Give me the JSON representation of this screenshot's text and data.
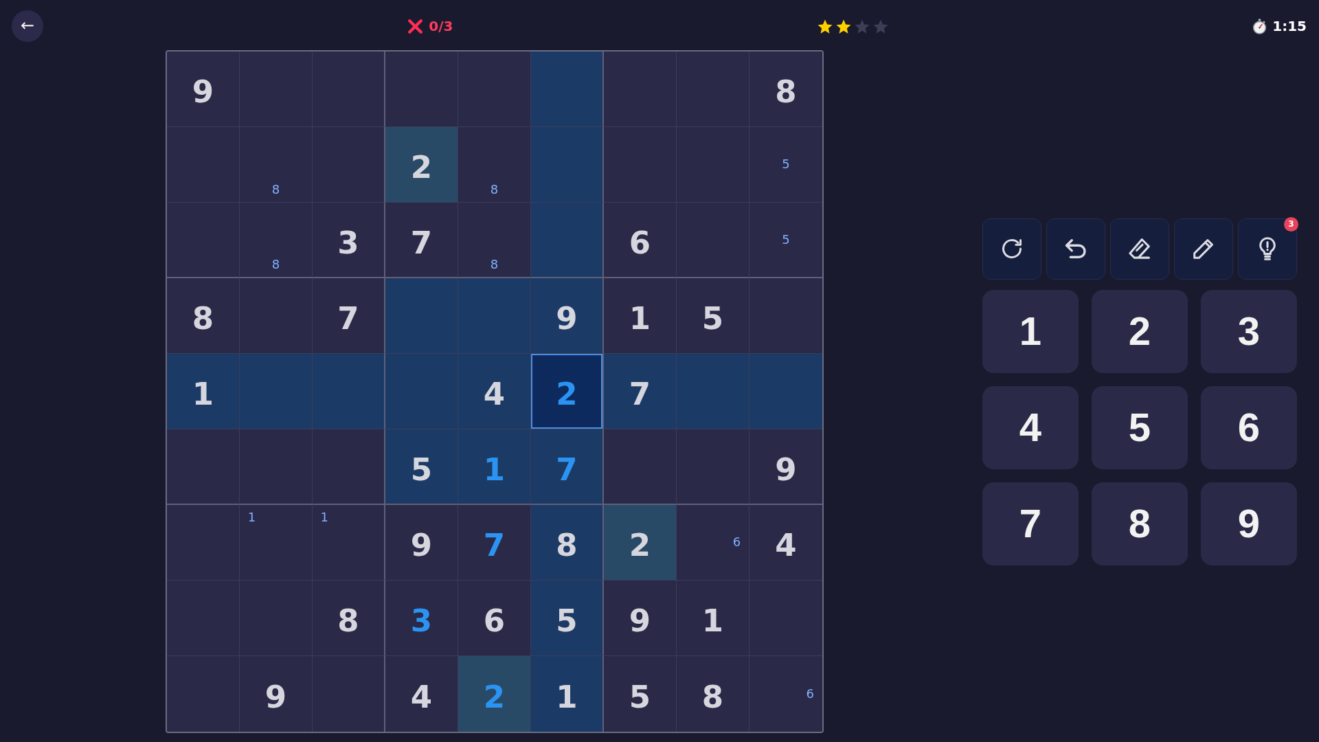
{
  "header": {
    "back_button": {
      "label": "←"
    },
    "mistakes": {
      "text": "0/3"
    },
    "rating": {
      "stars": 2
    },
    "timer": {
      "text": "1:15"
    }
  },
  "board": {
    "rows": [
      {
        "cells": [
          {
            "kind": "given",
            "value": "9",
            "selected": false,
            "related": false,
            "matching": false
          },
          {
            "kind": "empty",
            "selected": false,
            "related": false,
            "matching": false
          },
          {
            "kind": "empty",
            "selected": false,
            "related": false,
            "matching": false
          },
          {
            "kind": "empty",
            "selected": false,
            "related": false,
            "matching": false
          },
          {
            "kind": "empty",
            "selected": false,
            "related": false,
            "matching": false
          },
          {
            "kind": "empty",
            "selected": false,
            "related": true,
            "matching": false
          },
          {
            "kind": "empty",
            "selected": false,
            "related": false,
            "matching": false
          },
          {
            "kind": "empty",
            "selected": false,
            "related": false,
            "matching": false
          },
          {
            "kind": "given",
            "value": "8",
            "selected": false,
            "related": false,
            "matching": false
          }
        ]
      },
      {
        "cells": [
          {
            "kind": "empty",
            "selected": false,
            "related": false,
            "matching": false
          },
          {
            "kind": "notes",
            "notes": [
              {
                "text": "8",
                "kind": "bottomcenter"
              }
            ],
            "selected": false,
            "related": false,
            "matching": false
          },
          {
            "kind": "empty",
            "selected": false,
            "related": false,
            "matching": false
          },
          {
            "kind": "given",
            "value": "2",
            "selected": false,
            "related": false,
            "matching": true
          },
          {
            "kind": "notes",
            "notes": [
              {
                "text": "8",
                "kind": "bottomcenter"
              }
            ],
            "selected": false,
            "related": false,
            "matching": false
          },
          {
            "kind": "empty",
            "selected": false,
            "related": true,
            "matching": false
          },
          {
            "kind": "empty",
            "selected": false,
            "related": false,
            "matching": false
          },
          {
            "kind": "empty",
            "selected": false,
            "related": false,
            "matching": false
          },
          {
            "kind": "notes",
            "notes": [
              {
                "text": "5",
                "kind": "center"
              }
            ],
            "selected": false,
            "related": false,
            "matching": false
          }
        ]
      },
      {
        "cells": [
          {
            "kind": "empty",
            "selected": false,
            "related": false,
            "matching": false
          },
          {
            "kind": "notes",
            "notes": [
              {
                "text": "8",
                "kind": "bottomcenter"
              }
            ],
            "selected": false,
            "related": false,
            "matching": false
          },
          {
            "kind": "given",
            "value": "3",
            "selected": false,
            "related": false,
            "matching": false
          },
          {
            "kind": "given",
            "value": "7",
            "selected": false,
            "related": false,
            "matching": false
          },
          {
            "kind": "notes",
            "notes": [
              {
                "text": "8",
                "kind": "bottomcenter"
              }
            ],
            "selected": false,
            "related": false,
            "matching": false
          },
          {
            "kind": "empty",
            "selected": false,
            "related": true,
            "matching": false
          },
          {
            "kind": "given",
            "value": "6",
            "selected": false,
            "related": false,
            "matching": false
          },
          {
            "kind": "empty",
            "selected": false,
            "related": false,
            "matching": false
          },
          {
            "kind": "notes",
            "notes": [
              {
                "text": "5",
                "kind": "center"
              }
            ],
            "selected": false,
            "related": false,
            "matching": false
          }
        ]
      },
      {
        "cells": [
          {
            "kind": "given",
            "value": "8",
            "selected": false,
            "related": false,
            "matching": false
          },
          {
            "kind": "empty",
            "selected": false,
            "related": false,
            "matching": false
          },
          {
            "kind": "given",
            "value": "7",
            "selected": false,
            "related": false,
            "matching": false
          },
          {
            "kind": "empty",
            "selected": false,
            "related": true,
            "matching": false
          },
          {
            "kind": "empty",
            "selected": false,
            "related": true,
            "matching": false
          },
          {
            "kind": "given",
            "value": "9",
            "selected": false,
            "related": true,
            "matching": false
          },
          {
            "kind": "given",
            "value": "1",
            "selected": false,
            "related": false,
            "matching": false
          },
          {
            "kind": "given",
            "value": "5",
            "selected": false,
            "related": false,
            "matching": false
          },
          {
            "kind": "empty",
            "selected": false,
            "related": false,
            "matching": false
          }
        ]
      },
      {
        "cells": [
          {
            "kind": "given",
            "value": "1",
            "selected": false,
            "related": true,
            "matching": false
          },
          {
            "kind": "empty",
            "selected": false,
            "related": true,
            "matching": false
          },
          {
            "kind": "empty",
            "selected": false,
            "related": true,
            "matching": false
          },
          {
            "kind": "empty",
            "selected": false,
            "related": true,
            "matching": false
          },
          {
            "kind": "given",
            "value": "4",
            "selected": false,
            "related": true,
            "matching": false
          },
          {
            "kind": "entered",
            "value": "2",
            "selected": true,
            "related": true,
            "matching": false
          },
          {
            "kind": "given",
            "value": "7",
            "selected": false,
            "related": true,
            "matching": false
          },
          {
            "kind": "empty",
            "selected": false,
            "related": true,
            "matching": false
          },
          {
            "kind": "empty",
            "selected": false,
            "related": true,
            "matching": false
          }
        ]
      },
      {
        "cells": [
          {
            "kind": "empty",
            "selected": false,
            "related": false,
            "matching": false
          },
          {
            "kind": "empty",
            "selected": false,
            "related": false,
            "matching": false
          },
          {
            "kind": "empty",
            "selected": false,
            "related": false,
            "matching": false
          },
          {
            "kind": "given",
            "value": "5",
            "selected": false,
            "related": true,
            "matching": false
          },
          {
            "kind": "entered",
            "value": "1",
            "selected": false,
            "related": true,
            "matching": false
          },
          {
            "kind": "entered",
            "value": "7",
            "selected": false,
            "related": true,
            "matching": false
          },
          {
            "kind": "empty",
            "selected": false,
            "related": false,
            "matching": false
          },
          {
            "kind": "empty",
            "selected": false,
            "related": false,
            "matching": false
          },
          {
            "kind": "given",
            "value": "9",
            "selected": false,
            "related": false,
            "matching": false
          }
        ]
      },
      {
        "cells": [
          {
            "kind": "empty",
            "selected": false,
            "related": false,
            "matching": false
          },
          {
            "kind": "notes",
            "notes": [
              {
                "text": "1",
                "kind": "topleft"
              }
            ],
            "selected": false,
            "related": false,
            "matching": false
          },
          {
            "kind": "notes",
            "notes": [
              {
                "text": "1",
                "kind": "topleft"
              }
            ],
            "selected": false,
            "related": false,
            "matching": false
          },
          {
            "kind": "given",
            "value": "9",
            "selected": false,
            "related": false,
            "matching": false
          },
          {
            "kind": "entered",
            "value": "7",
            "selected": false,
            "related": false,
            "matching": false
          },
          {
            "kind": "given",
            "value": "8",
            "selected": false,
            "related": true,
            "matching": false
          },
          {
            "kind": "given",
            "value": "2",
            "selected": false,
            "related": false,
            "matching": true
          },
          {
            "kind": "notes",
            "notes": [
              {
                "text": "6",
                "kind": "midright"
              }
            ],
            "selected": false,
            "related": false,
            "matching": false
          },
          {
            "kind": "given",
            "value": "4",
            "selected": false,
            "related": false,
            "matching": false
          }
        ]
      },
      {
        "cells": [
          {
            "kind": "empty",
            "selected": false,
            "related": false,
            "matching": false
          },
          {
            "kind": "empty",
            "selected": false,
            "related": false,
            "matching": false
          },
          {
            "kind": "given",
            "value": "8",
            "selected": false,
            "related": false,
            "matching": false
          },
          {
            "kind": "entered",
            "value": "3",
            "selected": false,
            "related": false,
            "matching": false
          },
          {
            "kind": "given",
            "value": "6",
            "selected": false,
            "related": false,
            "matching": false
          },
          {
            "kind": "given",
            "value": "5",
            "selected": false,
            "related": true,
            "matching": false
          },
          {
            "kind": "given",
            "value": "9",
            "selected": false,
            "related": false,
            "matching": false
          },
          {
            "kind": "given",
            "value": "1",
            "selected": false,
            "related": false,
            "matching": false
          },
          {
            "kind": "empty",
            "selected": false,
            "related": false,
            "matching": false
          }
        ]
      },
      {
        "cells": [
          {
            "kind": "empty",
            "selected": false,
            "related": false,
            "matching": false
          },
          {
            "kind": "given",
            "value": "9",
            "selected": false,
            "related": false,
            "matching": false
          },
          {
            "kind": "empty",
            "selected": false,
            "related": false,
            "matching": false
          },
          {
            "kind": "given",
            "value": "4",
            "selected": false,
            "related": false,
            "matching": false
          },
          {
            "kind": "entered",
            "value": "2",
            "selected": false,
            "related": false,
            "matching": true
          },
          {
            "kind": "given",
            "value": "1",
            "selected": false,
            "related": true,
            "matching": false
          },
          {
            "kind": "given",
            "value": "5",
            "selected": false,
            "related": false,
            "matching": false
          },
          {
            "kind": "given",
            "value": "8",
            "selected": false,
            "related": false,
            "matching": false
          },
          {
            "kind": "notes",
            "notes": [
              {
                "text": "6",
                "kind": "midright"
              }
            ],
            "selected": false,
            "related": false,
            "matching": false
          }
        ]
      }
    ]
  },
  "tools": [
    {
      "kind": "restart"
    },
    {
      "kind": "undo"
    },
    {
      "kind": "erase"
    },
    {
      "kind": "pencil"
    },
    {
      "kind": "hint",
      "badge": "3"
    }
  ],
  "keypad": [
    "1",
    "2",
    "3",
    "4",
    "5",
    "6",
    "7",
    "8",
    "9"
  ]
}
